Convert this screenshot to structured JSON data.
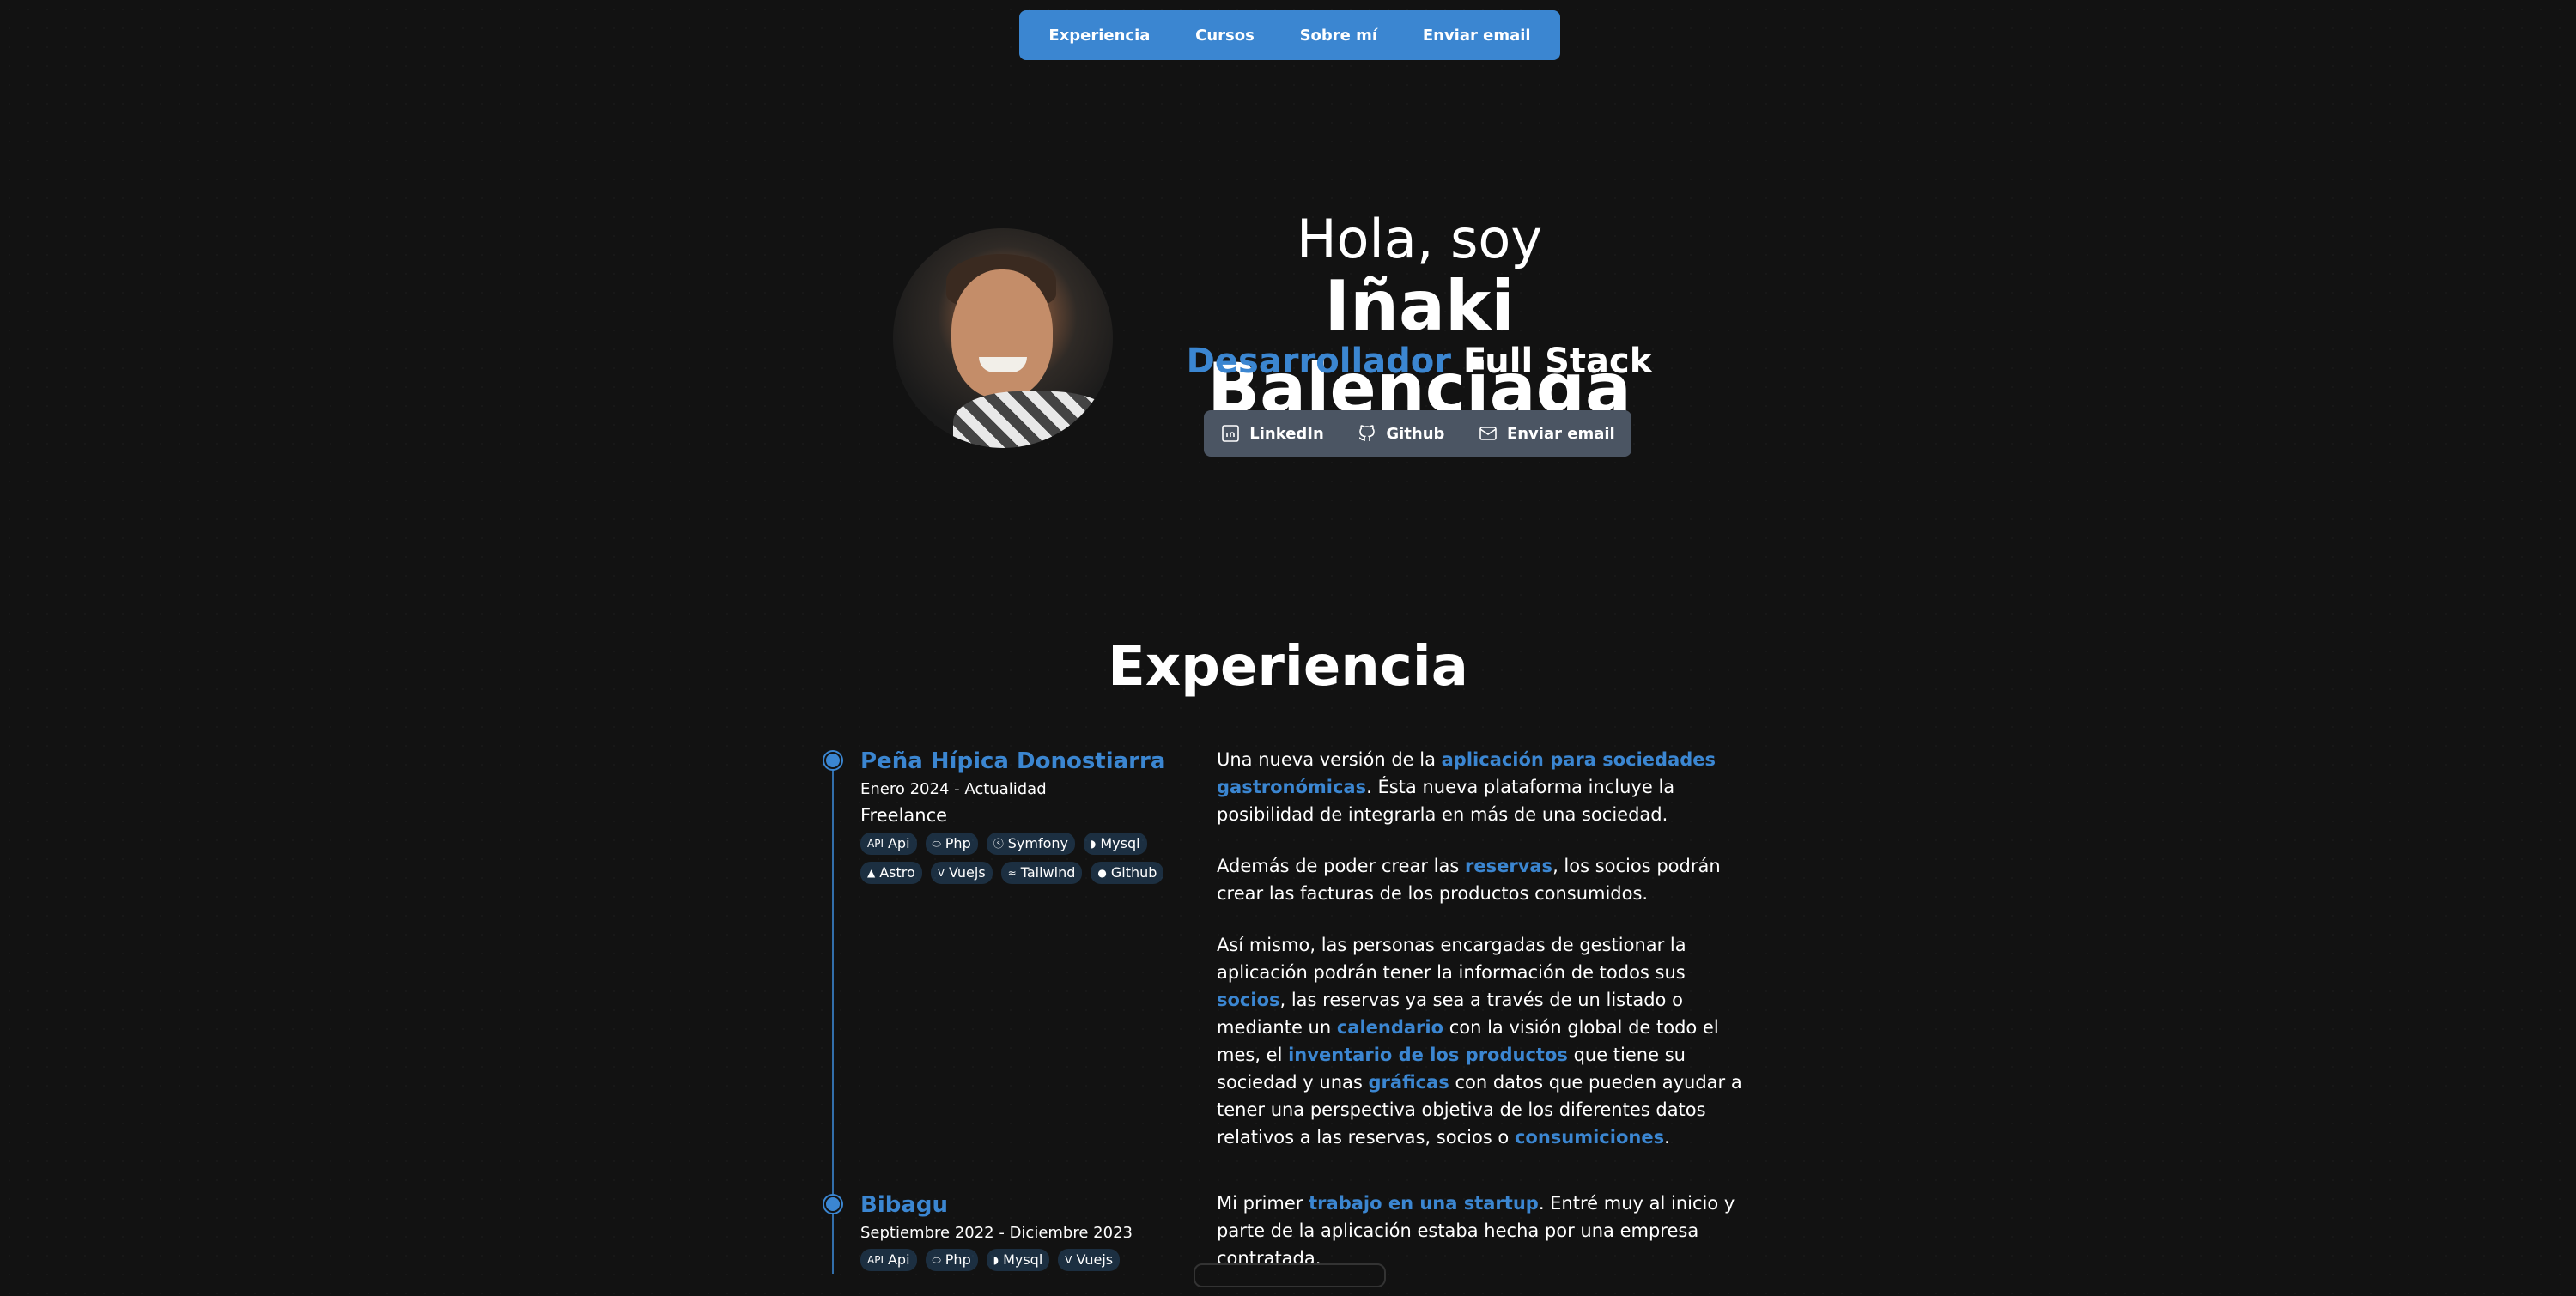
{
  "nav": {
    "items": [
      "Experiencia",
      "Cursos",
      "Sobre mí",
      "Enviar email"
    ]
  },
  "hero": {
    "greeting": "Hola, soy",
    "name": "Iñaki Balenciaga",
    "role_highlight": "Desarrollador",
    "role_rest": "Full Stack",
    "social": [
      {
        "label": "LinkedIn",
        "icon": "linkedin-icon"
      },
      {
        "label": "Github",
        "icon": "github-icon"
      },
      {
        "label": "Enviar email",
        "icon": "mail-icon"
      }
    ]
  },
  "experience": {
    "title": "Experiencia",
    "jobs": [
      {
        "company": "Peña Hípica Donostiarra",
        "dates": "Enero 2024 - Actualidad",
        "type": "Freelance",
        "tags": [
          {
            "label": "Api",
            "icon": "API"
          },
          {
            "label": "Php",
            "icon": "php-icon"
          },
          {
            "label": "Symfony",
            "icon": "symfony-icon"
          },
          {
            "label": "Mysql",
            "icon": "mysql-icon"
          },
          {
            "label": "Astro",
            "icon": "astro-icon"
          },
          {
            "label": "Vuejs",
            "icon": "vue-icon"
          },
          {
            "label": "Tailwind",
            "icon": "tailwind-icon"
          },
          {
            "label": "Github",
            "icon": "github-icon"
          }
        ],
        "paragraphs": [
          [
            {
              "t": "Una nueva versión de la "
            },
            {
              "t": "aplicación para sociedades gastronómicas",
              "hl": true
            },
            {
              "t": ". Ésta nueva plataforma incluye la posibilidad de integrarla en más de una sociedad."
            }
          ],
          [
            {
              "t": "Además de poder crear las "
            },
            {
              "t": "reservas",
              "hl": true
            },
            {
              "t": ", los socios podrán crear las facturas de los productos consumidos."
            }
          ],
          [
            {
              "t": "Así mismo, las personas encargadas de gestionar la aplicación podrán tener la información de todos sus "
            },
            {
              "t": "socios",
              "hl": true
            },
            {
              "t": ", las reservas ya sea a través de un listado o mediante un "
            },
            {
              "t": "calendario",
              "hl": true
            },
            {
              "t": " con la visión global de todo el mes, el "
            },
            {
              "t": "inventario de los productos",
              "hl": true
            },
            {
              "t": " que tiene su sociedad y unas "
            },
            {
              "t": "gráficas",
              "hl": true
            },
            {
              "t": " con datos que pueden ayudar a tener una perspectiva objetiva de los diferentes datos relativos a las reservas, socios o "
            },
            {
              "t": "consumiciones",
              "hl": true
            },
            {
              "t": "."
            }
          ]
        ]
      },
      {
        "company": "Bibagu",
        "dates": "Septiembre 2022 - Diciembre 2023",
        "tags": [
          {
            "label": "Api",
            "icon": "API"
          },
          {
            "label": "Php",
            "icon": "php-icon"
          },
          {
            "label": "Mysql",
            "icon": "mysql-icon"
          },
          {
            "label": "Vuejs",
            "icon": "vue-icon"
          }
        ],
        "paragraphs": [
          [
            {
              "t": "Mi primer "
            },
            {
              "t": "trabajo en una startup",
              "hl": true
            },
            {
              "t": ". Entré muy al inicio y parte de la aplicación estaba hecha por una empresa contratada."
            }
          ]
        ]
      }
    ]
  },
  "colors": {
    "accent": "#3b86d1",
    "background": "#121212",
    "social_bar": "#4b5563"
  }
}
